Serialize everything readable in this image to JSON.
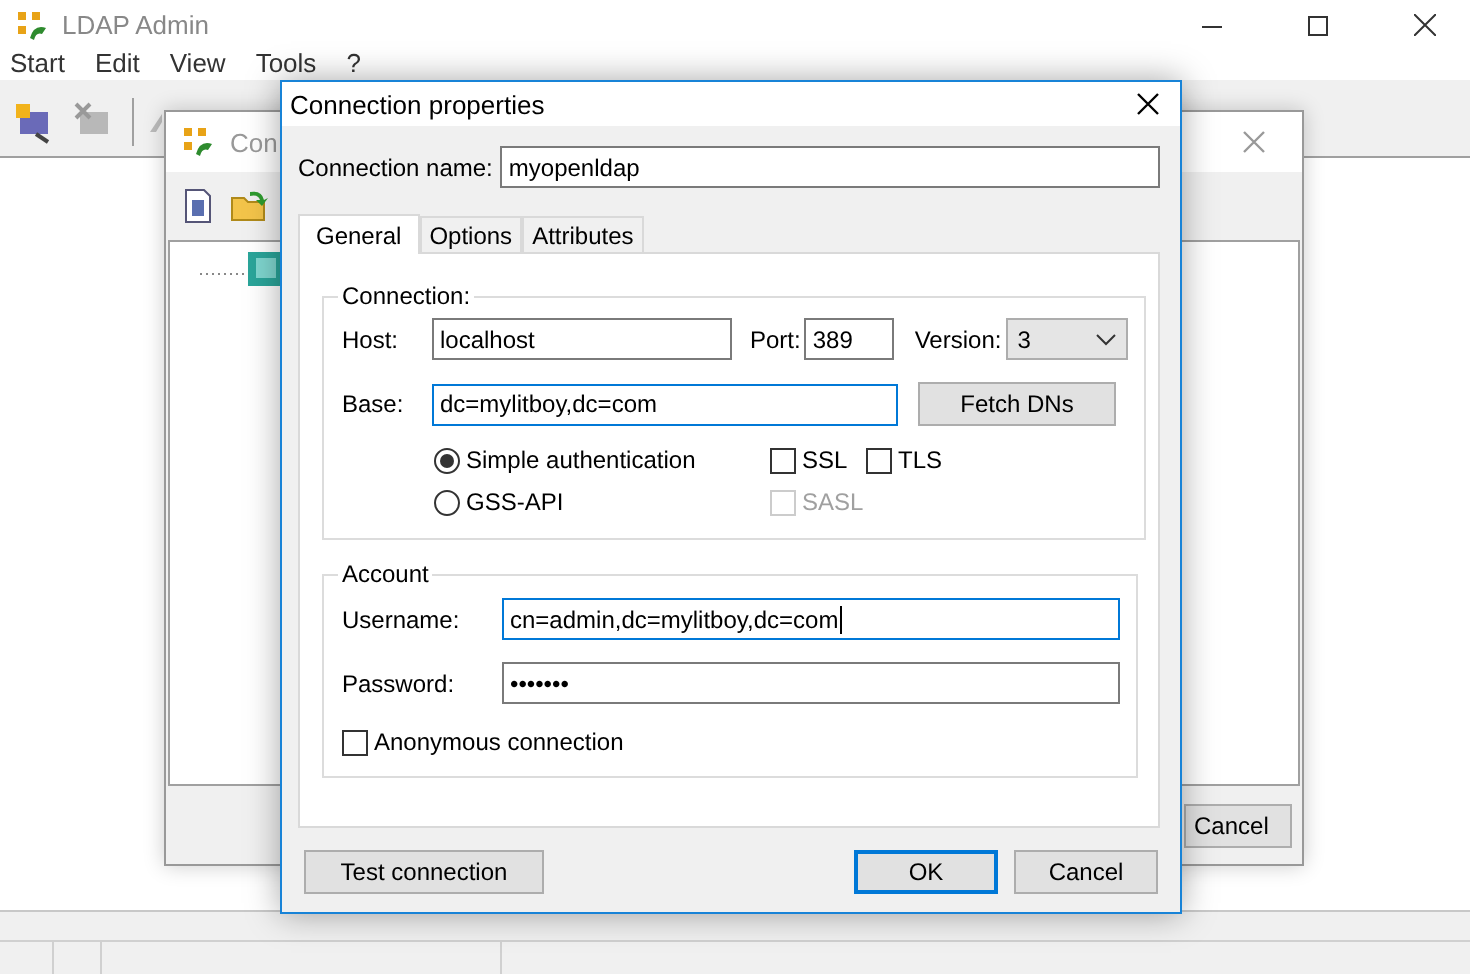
{
  "main_window": {
    "title": "LDAP Admin",
    "menu": [
      "Start",
      "Edit",
      "View",
      "Tools",
      "?"
    ]
  },
  "connections_window": {
    "title": "Con",
    "button": "Cancel"
  },
  "dialog": {
    "title": "Connection properties",
    "connection_name": {
      "label": "Connection name:",
      "value": "myopenldap",
      "focused": false
    },
    "tabs": [
      {
        "label": "General",
        "selected": true
      },
      {
        "label": "Options",
        "selected": false
      },
      {
        "label": "Attributes",
        "selected": false
      }
    ],
    "connection_group": {
      "legend": "Connection:",
      "host": {
        "label": "Host:",
        "value": "localhost",
        "focused": false
      },
      "port": {
        "label": "Port:",
        "value": "389",
        "focused": false
      },
      "version": {
        "label": "Version:",
        "value": "3"
      },
      "base": {
        "label": "Base:",
        "value": "dc=mylitboy,dc=com",
        "focused": true
      },
      "fetch_button": "Fetch DNs",
      "auth_options": [
        {
          "label": "Simple authentication",
          "selected": true
        },
        {
          "label": "GSS-API",
          "selected": false
        }
      ],
      "security_options": [
        {
          "label": "SSL",
          "checked": false,
          "disabled": false
        },
        {
          "label": "TLS",
          "checked": false,
          "disabled": false
        },
        {
          "label": "SASL",
          "checked": false,
          "disabled": true
        }
      ]
    },
    "account_group": {
      "legend": "Account",
      "username": {
        "label": "Username:",
        "value": "cn=admin,dc=mylitboy,dc=com",
        "focused": true
      },
      "password": {
        "label": "Password:",
        "value": "•••••••",
        "focused": false
      },
      "anonymous": {
        "label": "Anonymous connection",
        "checked": false
      }
    },
    "buttons": [
      {
        "label": "Test connection",
        "default": false
      },
      {
        "label": "OK",
        "default": true
      },
      {
        "label": "Cancel",
        "default": false
      }
    ]
  }
}
